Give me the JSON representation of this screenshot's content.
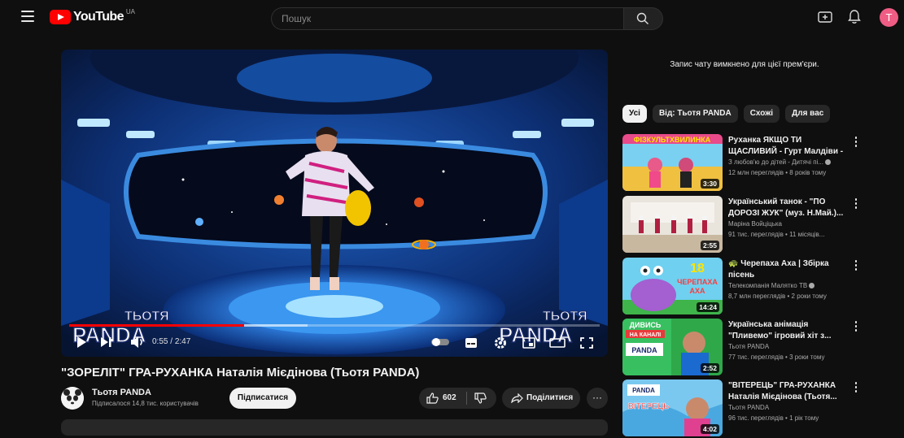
{
  "header": {
    "logo_text": "YouTube",
    "region": "UA",
    "search_placeholder": "Пошук",
    "avatar_letter": "T"
  },
  "player": {
    "time_current": "0:55",
    "time_total": "2:47",
    "progress": 0.33,
    "buffered": 0.45,
    "watermark_text": "ТЬОТЯ"
  },
  "video": {
    "title": "\"ЗОРЕЛІТ\" ГРА-РУХАНКА Наталія Мієдінова (Тьотя PANDA)",
    "channel": "Тьотя PANDA",
    "subscribers": "Підписалося 14,8 тис. користувачів",
    "subscribe_label": "Підписатися",
    "likes": "602",
    "share_label": "Поділитися",
    "more_label": "···"
  },
  "sidebar": {
    "chat_note": "Запис чату вимкнено для цієї прем'єри.",
    "chips": [
      "Усі",
      "Від: Тьотя PANDA",
      "Схожі",
      "Для вас"
    ],
    "recommendations": [
      {
        "title": "Руханка ЯКЩО ТИ ЩАСЛИВИЙ - Гурт Малдіви - ...",
        "channel": "З любов'ю до дітей - Дитячі пі...",
        "meta": "12 млн переглядів • 8 років тому",
        "duration": "3:30",
        "thumb_text": "ФІЗКУЛЬТХВИЛИНКА"
      },
      {
        "title": "Український танок - \"ПО ДОРОЗІ ЖУК\" (муз. Н.Май.)...",
        "channel": "Маріна Войціцька",
        "meta": "91 тис. переглядів • 11 місяців...",
        "duration": "2:55",
        "thumb_text": ""
      },
      {
        "title": "🐢 Черепаха Аха | Збірка пісень",
        "channel": "Телекомпанія Малятко ТВ",
        "meta": "8,7 млн переглядів • 2 роки тому",
        "duration": "14:24",
        "thumb_text": "18 хвилин ЧЕРЕПАХА АХА"
      },
      {
        "title": "Українська анімація \"Пливемо\" ігровий хіт з...",
        "channel": "Тьотя PANDA",
        "meta": "77 тис. переглядів • 3 роки тому",
        "duration": "2:52",
        "thumb_text": "ДИВИСЬ НА КАНАЛІ"
      },
      {
        "title": "\"ВІТЕРЕЦЬ\" ГРА-РУХАНКА Наталія Мієдінова (Тьотя...",
        "channel": "Тьотя PANDA",
        "meta": "96 тис. переглядів • 1 рік тому",
        "duration": "4:02",
        "thumb_text": "ВІТЕРЕЦЬ"
      }
    ]
  }
}
